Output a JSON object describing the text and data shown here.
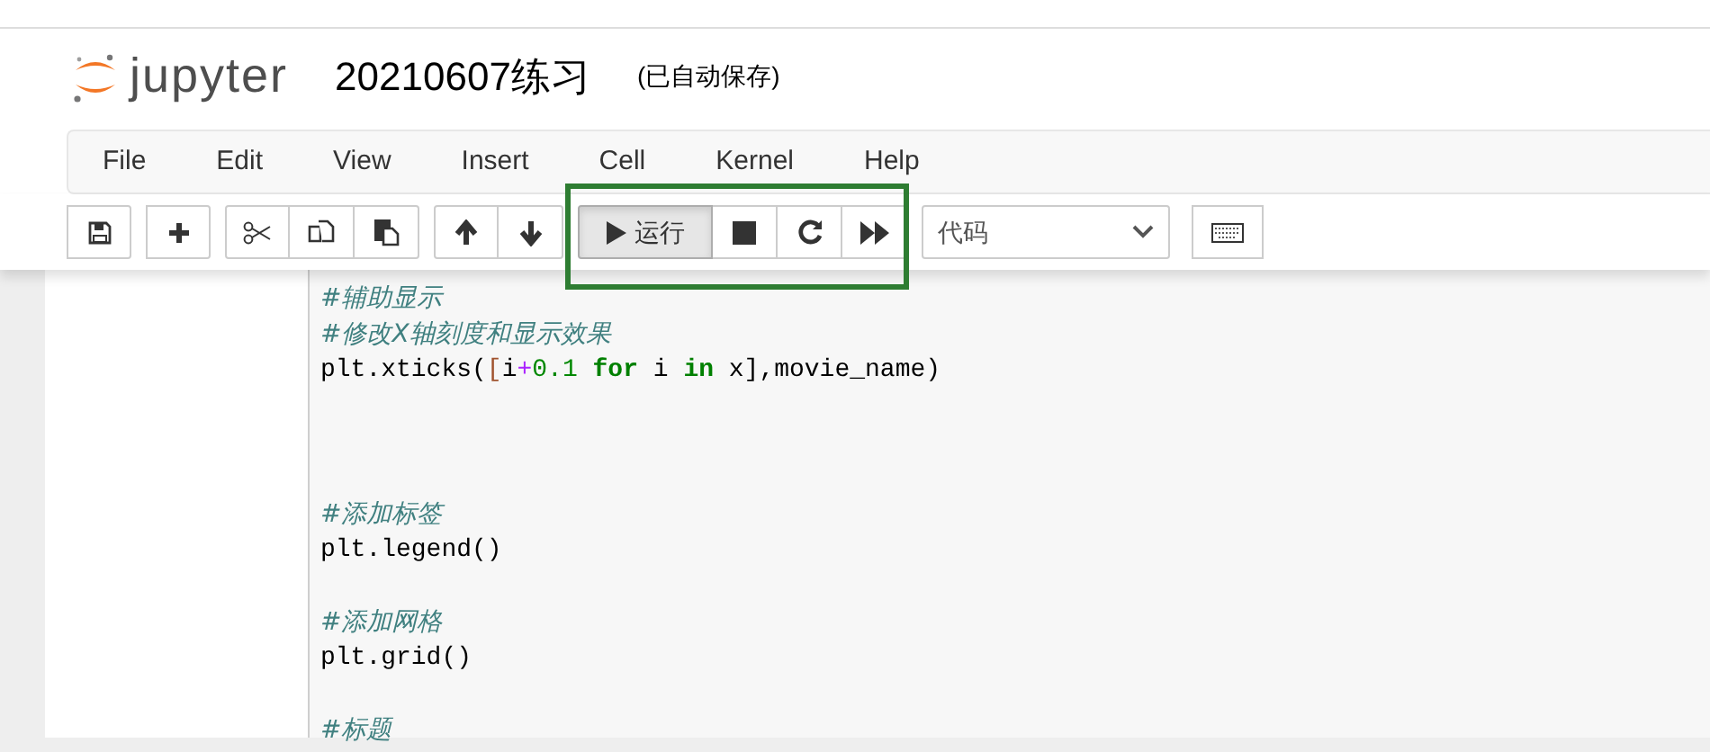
{
  "header": {
    "logo_text": "jupyter",
    "notebook_title": "20210607练习",
    "save_status": "(已自动保存)"
  },
  "menu": [
    "File",
    "Edit",
    "View",
    "Insert",
    "Cell",
    "Kernel",
    "Help"
  ],
  "toolbar": {
    "groups": [
      [
        {
          "kind": "save",
          "active": false
        }
      ],
      [
        {
          "kind": "insert",
          "active": false
        }
      ],
      [
        {
          "kind": "cut",
          "active": false
        },
        {
          "kind": "copy",
          "active": false
        },
        {
          "kind": "paste",
          "active": false
        }
      ],
      [
        {
          "kind": "up",
          "active": false
        },
        {
          "kind": "down",
          "active": false
        }
      ],
      [
        {
          "kind": "run",
          "label": "运行",
          "active": true
        },
        {
          "kind": "stop",
          "active": false
        },
        {
          "kind": "restart",
          "active": false
        },
        {
          "kind": "fastforward",
          "active": false
        }
      ]
    ],
    "cell_type": "代码",
    "keyboard": {
      "kind": "keyboard"
    }
  },
  "code_lines": [
    [
      {
        "kind": "comment",
        "text": "#辅助显示"
      }
    ],
    [
      {
        "kind": "comment",
        "text": "#修改X轴刻度和显示效果"
      }
    ],
    [
      {
        "kind": "name",
        "text": "plt.xticks("
      },
      {
        "kind": "punct",
        "text": "["
      },
      {
        "kind": "name",
        "text": "i"
      },
      {
        "kind": "operator",
        "text": "+"
      },
      {
        "kind": "number",
        "text": "0.1"
      },
      {
        "kind": "keyword",
        "text": " for"
      },
      {
        "kind": "name",
        "text": " i "
      },
      {
        "kind": "keyword",
        "text": "in"
      },
      {
        "kind": "name",
        "text": " x],movie_name)"
      }
    ],
    [
      {
        "kind": "blank"
      }
    ],
    [
      {
        "kind": "blank"
      }
    ],
    [
      {
        "kind": "blank"
      }
    ],
    [
      {
        "kind": "comment",
        "text": "#添加标签"
      }
    ],
    [
      {
        "kind": "name",
        "text": "plt.legend()"
      }
    ],
    [
      {
        "kind": "blank"
      }
    ],
    [
      {
        "kind": "comment",
        "text": "#添加网格"
      }
    ],
    [
      {
        "kind": "name",
        "text": "plt.grid()"
      }
    ],
    [
      {
        "kind": "blank"
      }
    ],
    [
      {
        "kind": "comment",
        "text": "#标题"
      }
    ]
  ]
}
